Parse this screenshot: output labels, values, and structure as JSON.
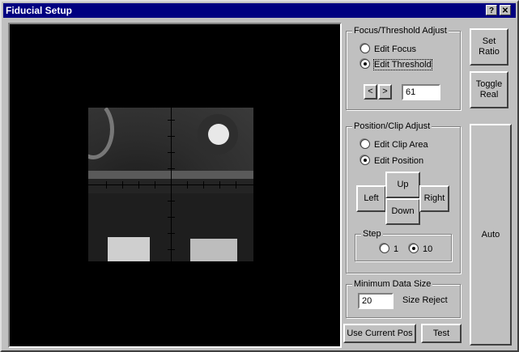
{
  "window": {
    "title": "Fiducial Setup",
    "help_label": "?",
    "close_label": "✕"
  },
  "focus_group": {
    "legend": "Focus/Threshold Adjust",
    "options": [
      "Edit Focus",
      "Edit Threshold"
    ],
    "selected": 1,
    "prev_label": "<",
    "next_label": ">",
    "value": "61"
  },
  "position_group": {
    "legend": "Position/Clip Adjust",
    "options": [
      "Edit Clip Area",
      "Edit Position"
    ],
    "selected": 1,
    "left": "Left",
    "up": "Up",
    "down": "Down",
    "right": "Right",
    "step": {
      "legend": "Step",
      "options": [
        "1",
        "10"
      ],
      "selected": 1
    }
  },
  "min_group": {
    "legend": "Minimum Data Size",
    "value": "20",
    "label": "Size Reject"
  },
  "buttons": {
    "set_ratio": "Set Ratio",
    "toggle_real": "Toggle Real",
    "auto": "Auto",
    "use_current_pos": "Use Current Pos",
    "test": "Test"
  }
}
